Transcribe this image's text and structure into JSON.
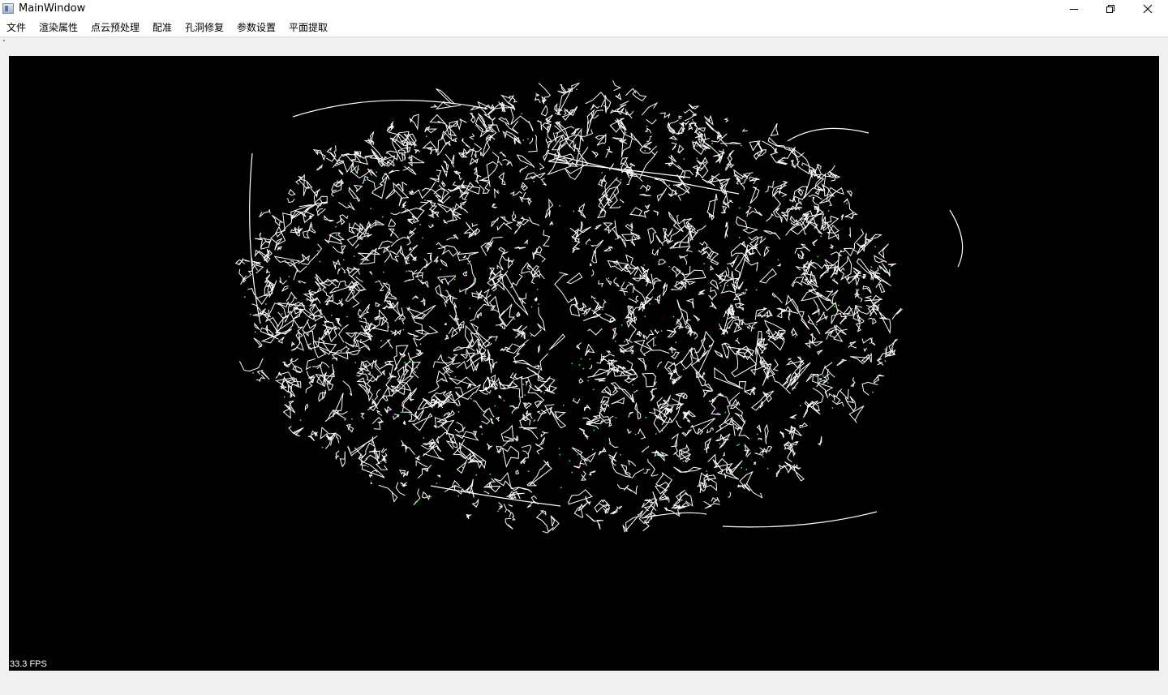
{
  "window": {
    "title": "MainWindow"
  },
  "window_controls": {
    "minimize_icon": "minimize-icon",
    "maximize_icon": "restore-icon",
    "close_icon": "close-icon"
  },
  "menu": {
    "items": [
      "文件",
      "渲染属性",
      "点云预处理",
      "配准",
      "孔洞修复",
      "参数设置",
      "平面提取"
    ]
  },
  "viewport": {
    "fps_text": "33.3 FPS",
    "background_color": "#000000",
    "edge_color": "#ffffff",
    "highlight_color": "#5aff5a"
  }
}
